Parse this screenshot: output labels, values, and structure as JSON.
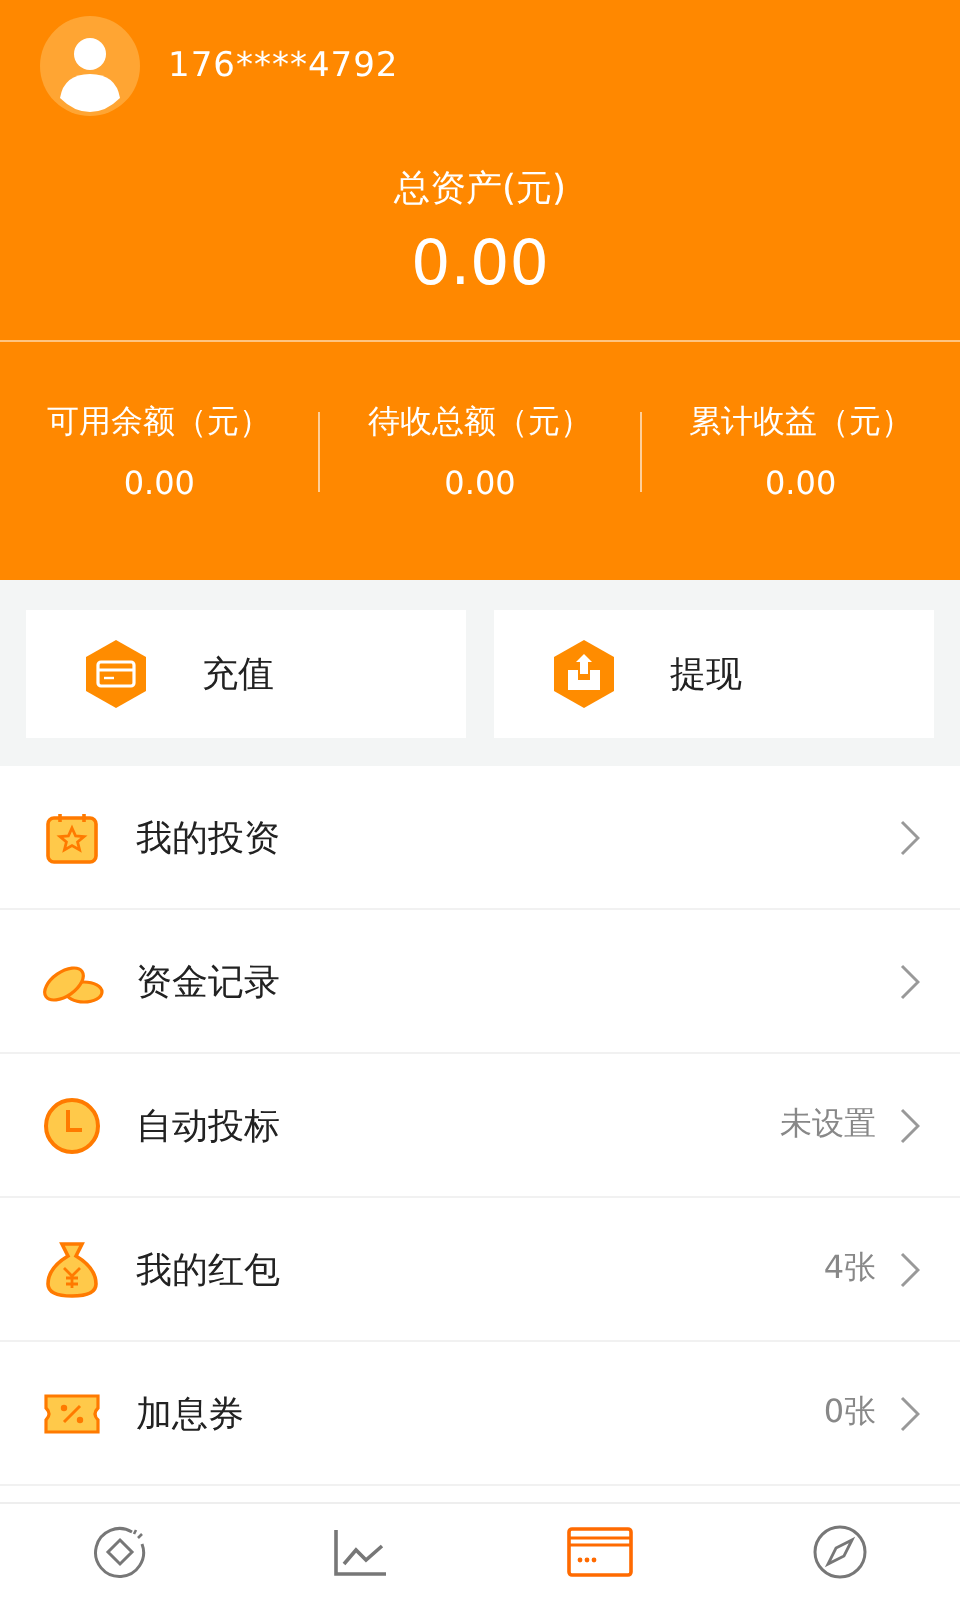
{
  "account": {
    "phone": "176****4792"
  },
  "total_assets": {
    "label": "总资产(元)",
    "value": "0.00"
  },
  "stats": [
    {
      "label": "可用余额（元）",
      "value": "0.00"
    },
    {
      "label": "待收总额（元）",
      "value": "0.00"
    },
    {
      "label": "累计收益（元）",
      "value": "0.00"
    }
  ],
  "actions": [
    {
      "kind": "recharge",
      "label": "充值"
    },
    {
      "kind": "withdraw",
      "label": "提现"
    }
  ],
  "menu": [
    {
      "kind": "investment",
      "label": "我的投资"
    },
    {
      "kind": "records",
      "label": "资金记录"
    },
    {
      "kind": "auto",
      "label": "自动投标",
      "value": "未设置"
    },
    {
      "kind": "redpacket",
      "label": "我的红包",
      "value": "4张"
    },
    {
      "kind": "coupon",
      "label": "加息券",
      "value": "0张"
    }
  ],
  "tab_bar": [
    {
      "kind": "home",
      "selected": false
    },
    {
      "kind": "chart",
      "selected": false
    },
    {
      "kind": "card",
      "selected": true
    },
    {
      "kind": "compass",
      "selected": false
    }
  ]
}
